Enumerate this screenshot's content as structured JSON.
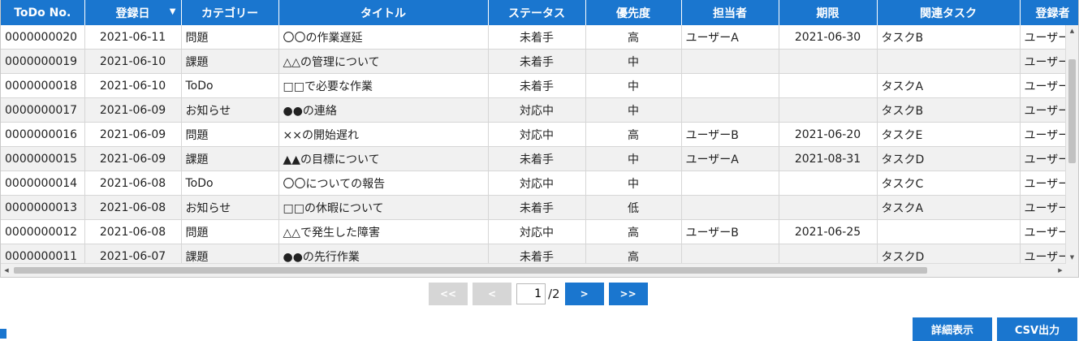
{
  "grid": {
    "columns": [
      {
        "label": "ToDo No.",
        "width": 103
      },
      {
        "label": "登録日",
        "width": 119,
        "sort": "▼"
      },
      {
        "label": "カテゴリー",
        "width": 120
      },
      {
        "label": "タイトル",
        "width": 258
      },
      {
        "label": "ステータス",
        "width": 120
      },
      {
        "label": "優先度",
        "width": 118
      },
      {
        "label": "担当者",
        "width": 120
      },
      {
        "label": "期限",
        "width": 121
      },
      {
        "label": "関連タスク",
        "width": 176
      },
      {
        "label": "登録者",
        "width": 81
      }
    ],
    "rows": [
      [
        "0000000020",
        "2021-06-11",
        "問題",
        "〇〇の作業遅延",
        "未着手",
        "高",
        "ユーザーA",
        "2021-06-30",
        "タスクB",
        "ユーザーD"
      ],
      [
        "0000000019",
        "2021-06-10",
        "課題",
        "△△の管理について",
        "未着手",
        "中",
        "",
        "",
        "",
        "ユーザーB"
      ],
      [
        "0000000018",
        "2021-06-10",
        "ToDo",
        "□□で必要な作業",
        "未着手",
        "中",
        "",
        "",
        "タスクA",
        "ユーザーA"
      ],
      [
        "0000000017",
        "2021-06-09",
        "お知らせ",
        "●●の連絡",
        "対応中",
        "中",
        "",
        "",
        "タスクB",
        "ユーザーC"
      ],
      [
        "0000000016",
        "2021-06-09",
        "問題",
        "××の開始遅れ",
        "対応中",
        "高",
        "ユーザーB",
        "2021-06-20",
        "タスクE",
        "ユーザーC"
      ],
      [
        "0000000015",
        "2021-06-09",
        "課題",
        "▲▲の目標について",
        "未着手",
        "中",
        "ユーザーA",
        "2021-08-31",
        "タスクD",
        "ユーザーD"
      ],
      [
        "0000000014",
        "2021-06-08",
        "ToDo",
        "〇〇についての報告",
        "対応中",
        "中",
        "",
        "",
        "タスクC",
        "ユーザーD"
      ],
      [
        "0000000013",
        "2021-06-08",
        "お知らせ",
        "□□の休暇について",
        "未着手",
        "低",
        "",
        "",
        "タスクA",
        "ユーザーB"
      ],
      [
        "0000000012",
        "2021-06-08",
        "問題",
        "△△で発生した障害",
        "対応中",
        "高",
        "ユーザーB",
        "2021-06-25",
        "",
        "ユーザーC"
      ],
      [
        "0000000011",
        "2021-06-07",
        "課題",
        "●●の先行作業",
        "未着手",
        "高",
        "",
        "",
        "タスクD",
        "ユーザーA"
      ]
    ]
  },
  "pager": {
    "first": "<<",
    "prev": "<",
    "current": "1",
    "total": "/2",
    "next": ">",
    "last": ">>"
  },
  "actions": {
    "detail": "詳細表示",
    "csv": "CSV出力"
  },
  "colors": {
    "accent": "#1a76cf",
    "disabled": "#d6d6d6"
  }
}
